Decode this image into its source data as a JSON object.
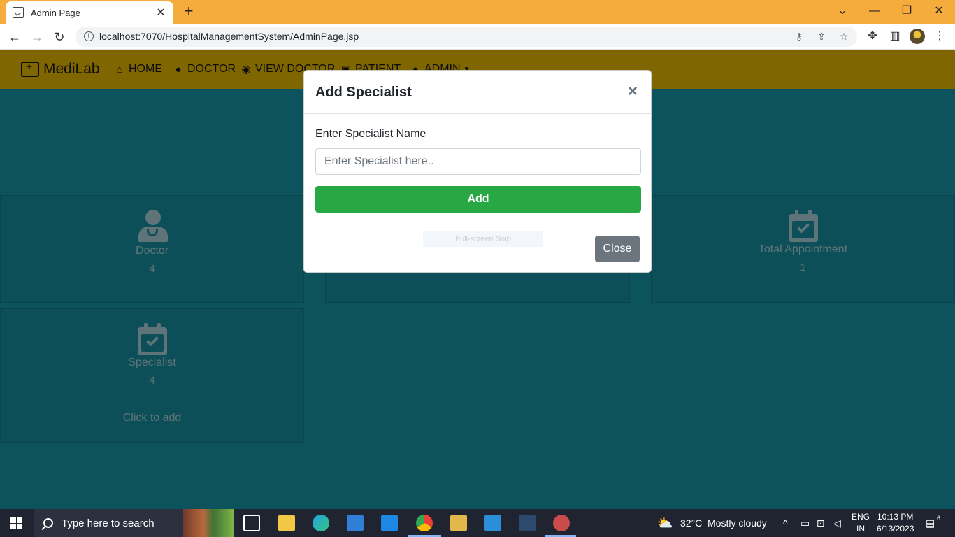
{
  "browser": {
    "tab_title": "Admin Page",
    "url": "localhost:7070/HospitalManagementSystem/AdminPage.jsp"
  },
  "navbar": {
    "brand": "MediLab",
    "links": [
      {
        "label": "HOME",
        "icon": "home-icon"
      },
      {
        "label": "DOCTOR",
        "icon": "user-md-icon"
      },
      {
        "label": "VIEW DOCTOR",
        "icon": "eye-icon"
      },
      {
        "label": "PATIENT",
        "icon": "id-card-icon"
      },
      {
        "label": "ADMIN",
        "icon": "user-icon"
      }
    ]
  },
  "cards": [
    {
      "label": "Doctor",
      "value": "4",
      "icon": "doctor-icon"
    },
    {
      "label": "Total Appointment",
      "value": "1",
      "icon": "calendar-check-icon"
    },
    {
      "label": "Specialist",
      "value": "4",
      "extra": "Click to add",
      "icon": "calendar-check-icon"
    }
  ],
  "modal": {
    "title": "Add Specialist",
    "close_symbol": "×",
    "field_label": "Enter Specialist Name",
    "field_placeholder": "Enter Specialist here..",
    "field_value": "",
    "add_label": "Add",
    "close_label": "Close",
    "snip_hint": "Full-screen Snip"
  },
  "taskbar": {
    "search_placeholder": "Type here to search",
    "weather_temp": "32°C",
    "weather_text": "Mostly cloudy",
    "lang_line1": "ENG",
    "lang_line2": "IN",
    "time": "10:13 PM",
    "date": "6/13/2023",
    "notification_count": "6"
  },
  "colors": {
    "chrome_frame": "#f6ac3d",
    "navbar": "#ffcc00",
    "page_bg": "#1aa7bd",
    "add_button": "#28a745",
    "close_button": "#6c757d"
  }
}
